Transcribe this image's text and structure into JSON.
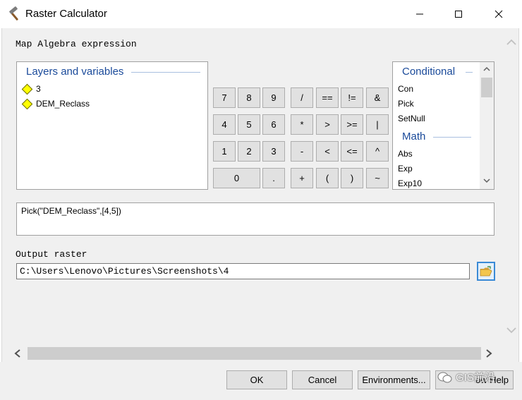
{
  "window": {
    "title": "Raster Calculator",
    "title_icon": "hammer-icon"
  },
  "labels": {
    "expression": "Map Algebra expression",
    "output": "Output raster"
  },
  "layers": {
    "header": "Layers and variables",
    "items": [
      "3",
      "DEM_Reclass"
    ]
  },
  "keypad": {
    "row1": [
      "7",
      "8",
      "9",
      "/",
      "==",
      "!=",
      "&"
    ],
    "row2": [
      "4",
      "5",
      "6",
      "*",
      ">",
      ">=",
      "|"
    ],
    "row3": [
      "1",
      "2",
      "3",
      "-",
      "<",
      "<=",
      "^"
    ],
    "row4": [
      "0",
      ".",
      "+",
      "(",
      ")",
      "~"
    ]
  },
  "functions": {
    "group1": "Conditional",
    "group1_items": [
      "Con",
      "Pick",
      "SetNull"
    ],
    "group2": "Math",
    "group2_items": [
      "Abs",
      "Exp",
      "Exp10"
    ]
  },
  "expression_value": "Pick(\"DEM_Reclass\",[4,5])",
  "output_value": "C:\\Users\\Lenovo\\Pictures\\Screenshots\\4",
  "buttons": {
    "ok": "OK",
    "cancel": "Cancel",
    "environments": "Environments...",
    "show_help": "ow Help"
  },
  "watermark": "GIS前沿",
  "colors": {
    "group_header": "#1a4a9a",
    "accent": "#3a8ad6"
  }
}
